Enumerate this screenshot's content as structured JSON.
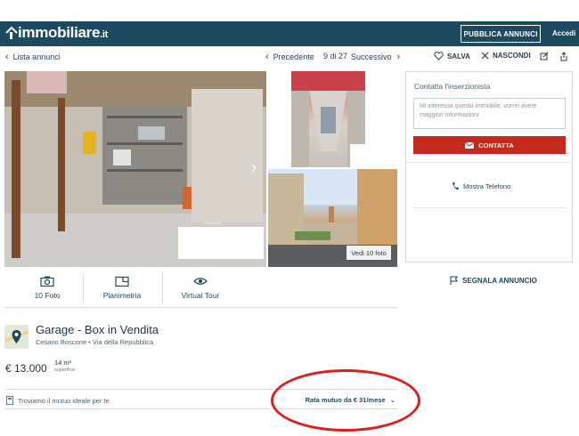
{
  "header": {
    "logo": "immobiliare",
    "logo_tld": ".it",
    "publish_label": "PUBBLICA ANNUNCI",
    "login_label": "Accedi"
  },
  "nav": {
    "back_label": "Lista annunci",
    "prev_label": "Precedente",
    "counter": "9 di 27",
    "next_label": "Successivo"
  },
  "actions": {
    "save_label": "SALVA",
    "hide_label": "NASCONDI"
  },
  "gallery": {
    "see_photos_label": "Vedi 10 foto"
  },
  "tabs": [
    {
      "label": "10 Foto",
      "icon": "camera-icon"
    },
    {
      "label": "Planimetria",
      "icon": "floorplan-icon"
    },
    {
      "label": "Virtual Tour",
      "icon": "eye-icon"
    }
  ],
  "listing": {
    "title": "Garage - Box in Vendita",
    "location": "Cesano Boscone • Via della Repubblica",
    "price": "€ 13.000",
    "surface_value": "14 m²",
    "surface_label": "superficie",
    "mortgage_text": "Troviamo il mutuo ideale per te",
    "mortgage_rate": "Rata mutuo da € 31/mese"
  },
  "contact": {
    "title": "Contatta l'inserzionista",
    "message_placeholder": "Mi interessa questo immobile, vorrei avere maggiori informazioni",
    "contact_label": "CONTATTA",
    "phone_label": "Mostra Telefono"
  },
  "report_label": "SEGNALA ANNUNCIO",
  "colors": {
    "header_bg": "#1e4a5f",
    "contact_button": "#c5281c",
    "highlight_circle": "#e01e1e"
  }
}
